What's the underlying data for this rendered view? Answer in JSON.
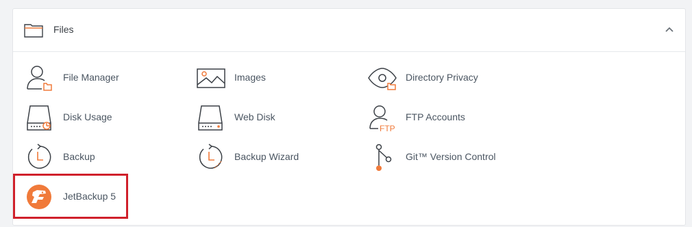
{
  "section": {
    "title": "Files",
    "header_icon": "folder-icon",
    "collapse_icon": "chevron-up-icon"
  },
  "items": [
    {
      "label": "File Manager",
      "icon": "file-manager-icon"
    },
    {
      "label": "Images",
      "icon": "image-icon"
    },
    {
      "label": "Directory Privacy",
      "icon": "eye-folder-icon"
    },
    {
      "label": "Disk Usage",
      "icon": "disk-usage-icon"
    },
    {
      "label": "Web Disk",
      "icon": "drive-icon"
    },
    {
      "label": "FTP Accounts",
      "icon": "ftp-user-icon"
    },
    {
      "label": "Backup",
      "icon": "backup-clock-icon"
    },
    {
      "label": "Backup Wizard",
      "icon": "backup-wizard-icon"
    },
    {
      "label": "Git™ Version Control",
      "icon": "git-branch-icon"
    },
    {
      "label": "JetBackup 5",
      "icon": "jetbackup-logo-icon"
    }
  ],
  "colors": {
    "accent": "#f07a3a",
    "icon_stroke": "#3a3f45",
    "highlight_border": "#d0202b",
    "label_text": "#4a5561"
  }
}
